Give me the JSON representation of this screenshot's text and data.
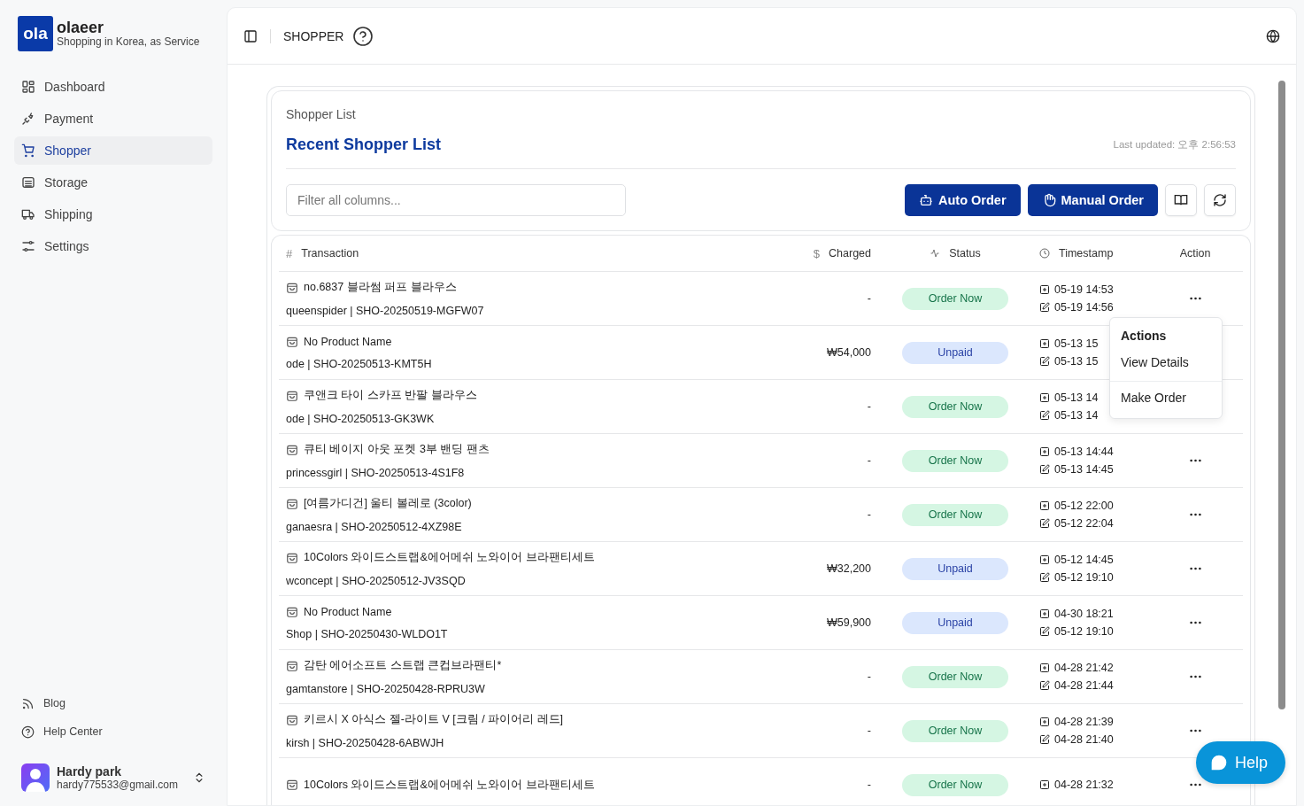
{
  "brand": {
    "logo": "ola",
    "name": "olaeer",
    "tagline": "Shopping in Korea, as Service"
  },
  "nav": [
    {
      "label": "Dashboard",
      "selected": false
    },
    {
      "label": "Payment",
      "selected": false
    },
    {
      "label": "Shopper",
      "selected": true
    },
    {
      "label": "Storage",
      "selected": false
    },
    {
      "label": "Shipping",
      "selected": false
    },
    {
      "label": "Settings",
      "selected": false
    }
  ],
  "footer_links": [
    "Blog",
    "Help Center"
  ],
  "user": {
    "name": "Hardy park",
    "email": "hardy775533@gmail.com"
  },
  "header": {
    "title": "SHOPPER"
  },
  "card": {
    "breadcrumb": "Shopper List",
    "title": "Recent Shopper List",
    "last_updated": "Last updated: 오후 2:56:53",
    "filter_placeholder": "Filter all columns...",
    "buttons": [
      "Auto Order",
      "Manual Order"
    ]
  },
  "table": {
    "columns": [
      {
        "icon": "#",
        "label": "Transaction"
      },
      {
        "icon": "$",
        "label": "Charged"
      },
      {
        "label": "Status"
      },
      {
        "label": "Timestamp"
      },
      {
        "label": "Action"
      }
    ],
    "rows": [
      {
        "name": "no.6837 블라썸 퍼프 블라우스",
        "sub": "queenspider | SHO-20250519-MGFW07",
        "charged": "-",
        "status": {
          "kind": "order",
          "label": "Order Now"
        },
        "created": "05-19 14:53",
        "modified": "05-19 14:56"
      },
      {
        "name": "No Product Name",
        "sub": "ode | SHO-20250513-KMT5H",
        "charged": "₩54,000",
        "status": {
          "kind": "unpaid",
          "label": "Unpaid"
        },
        "created": "05-13 15",
        "modified": "05-13 15"
      },
      {
        "name": "쿠앤크 타이 스카프 반팔 블라우스",
        "sub": "ode | SHO-20250513-GK3WK",
        "charged": "-",
        "status": {
          "kind": "order",
          "label": "Order Now"
        },
        "created": "05-13 14",
        "modified": "05-13 14"
      },
      {
        "name": "큐티 베이지 아웃 포켓 3부 밴딩 팬츠",
        "sub": "princessgirl | SHO-20250513-4S1F8",
        "charged": "-",
        "status": {
          "kind": "order",
          "label": "Order Now"
        },
        "created": "05-13 14:44",
        "modified": "05-13 14:45"
      },
      {
        "name": "[여름가디건] 울티 볼레로 (3color)",
        "sub": "ganaesra | SHO-20250512-4XZ98E",
        "charged": "-",
        "status": {
          "kind": "order",
          "label": "Order Now"
        },
        "created": "05-12 22:00",
        "modified": "05-12 22:04"
      },
      {
        "name": "10Colors 와이드스트랩&에어메쉬 노와이어 브라팬티세트",
        "sub": "wconcept | SHO-20250512-JV3SQD",
        "charged": "₩32,200",
        "status": {
          "kind": "unpaid",
          "label": "Unpaid"
        },
        "created": "05-12 14:45",
        "modified": "05-12 19:10"
      },
      {
        "name": "No Product Name",
        "sub": "Shop | SHO-20250430-WLDO1T",
        "charged": "₩59,900",
        "status": {
          "kind": "unpaid",
          "label": "Unpaid"
        },
        "created": "04-30 18:21",
        "modified": "05-12 19:10"
      },
      {
        "name": "감탄 에어소프트 스트랩 큰컵브라팬티*",
        "sub": "gamtanstore | SHO-20250428-RPRU3W",
        "charged": "-",
        "status": {
          "kind": "order",
          "label": "Order Now"
        },
        "created": "04-28 21:42",
        "modified": "04-28 21:44"
      },
      {
        "name": "키르시 X 아식스 젤-라이트 V [크림 / 파이어리 레드]",
        "sub": "kirsh | SHO-20250428-6ABWJH",
        "charged": "-",
        "status": {
          "kind": "order",
          "label": "Order Now"
        },
        "created": "04-28 21:39",
        "modified": "04-28 21:40"
      },
      {
        "name": "10Colors 와이드스트랩&에어메쉬 노와이어 브라팬티세트",
        "charged": "-",
        "status": {
          "kind": "order",
          "label": "Order Now"
        },
        "created": "04-28 21:32"
      }
    ]
  },
  "menu": {
    "title": "Actions",
    "items": [
      "View Details",
      "Make Order"
    ]
  },
  "help_button": "Help"
}
